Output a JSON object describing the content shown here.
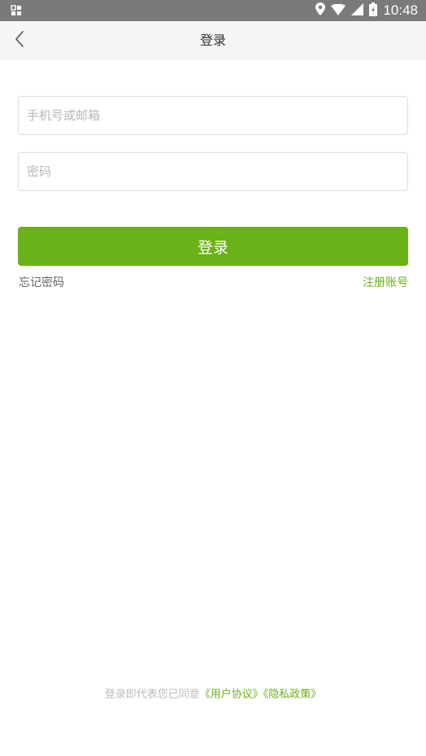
{
  "status_bar": {
    "time": "10:48",
    "icons": [
      "notification-icon",
      "location-icon",
      "wifi-icon",
      "signal-icon",
      "battery-icon"
    ]
  },
  "nav": {
    "title": "登录",
    "back_icon": "chevron-left-icon"
  },
  "form": {
    "phone_placeholder": "手机号或邮箱",
    "phone_value": "",
    "password_placeholder": "密码",
    "password_value": "",
    "login_label": "登录",
    "forgot_password": "忘记密码",
    "register": "注册账号"
  },
  "footer": {
    "agreement_prefix": "登录即代表您已同意",
    "user_agreement": "《用户协议》",
    "privacy_policy": "《隐私政策》"
  },
  "colors": {
    "accent": "#6ab217",
    "status_bar": "#7a7a7a",
    "nav_bg": "#f5f5f5",
    "placeholder": "#b8b8b8"
  }
}
